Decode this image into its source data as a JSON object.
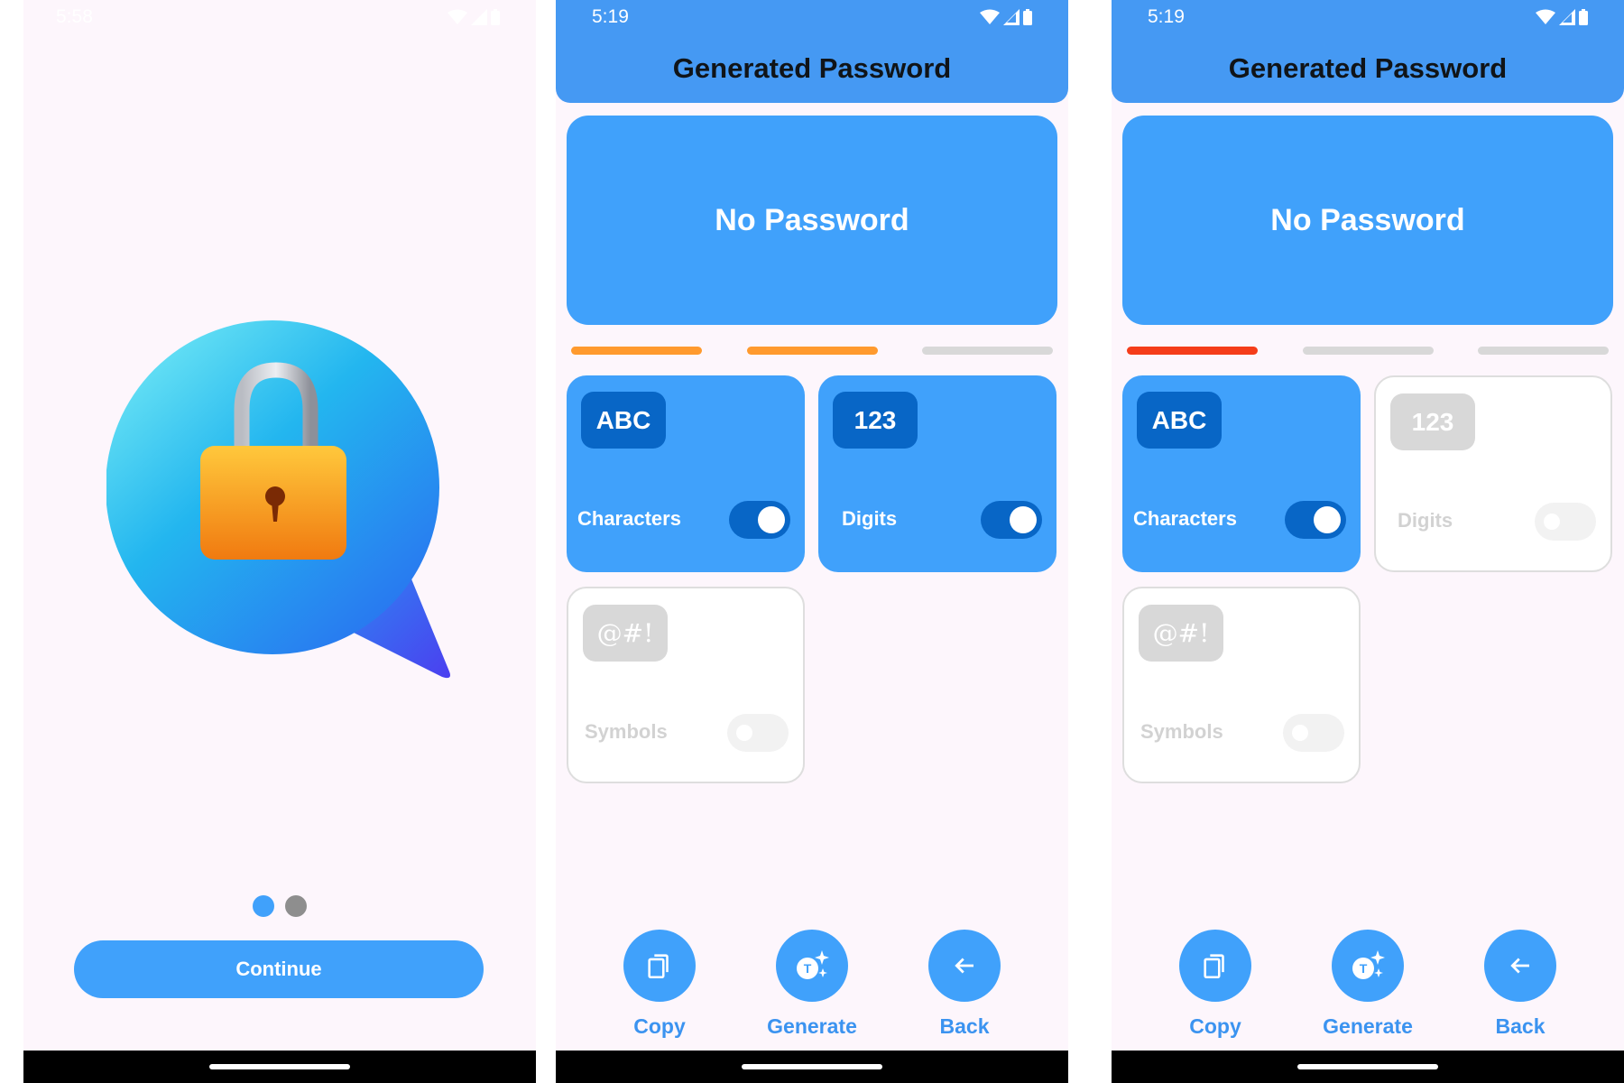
{
  "colors": {
    "primary": "#40a1fb",
    "dark_blue": "#0866c6",
    "orange": "#ff9a2e",
    "red": "#f53d1a",
    "grey": "#d8d8d8"
  },
  "onboarding": {
    "status_time": "5:58",
    "continue_label": "Continue",
    "page_indicator": {
      "pages": 2,
      "active": 1
    }
  },
  "screens": [
    {
      "status_time": "5:19",
      "title": "Generated Password",
      "password_text": "No Password",
      "strength": {
        "filled_segments": 2,
        "total_segments": 3,
        "color": "#ff9a2e"
      },
      "options": [
        {
          "badge": "ABC",
          "label": "Characters",
          "enabled": true
        },
        {
          "badge": "123",
          "label": "Digits",
          "enabled": true
        },
        {
          "badge": "@#!",
          "label": "Symbols",
          "enabled": false
        }
      ],
      "actions": [
        {
          "label": "Copy",
          "icon": "copy-icon"
        },
        {
          "label": "Generate",
          "icon": "generate-icon"
        },
        {
          "label": "Back",
          "icon": "arrow-back-icon"
        }
      ]
    },
    {
      "status_time": "5:19",
      "title": "Generated Password",
      "password_text": "No Password",
      "strength": {
        "filled_segments": 1,
        "total_segments": 3,
        "color": "#f53d1a"
      },
      "options": [
        {
          "badge": "ABC",
          "label": "Characters",
          "enabled": true
        },
        {
          "badge": "123",
          "label": "Digits",
          "enabled": false
        },
        {
          "badge": "@#!",
          "label": "Symbols",
          "enabled": false
        }
      ],
      "actions": [
        {
          "label": "Copy",
          "icon": "copy-icon"
        },
        {
          "label": "Generate",
          "icon": "generate-icon"
        },
        {
          "label": "Back",
          "icon": "arrow-back-icon"
        }
      ]
    }
  ]
}
